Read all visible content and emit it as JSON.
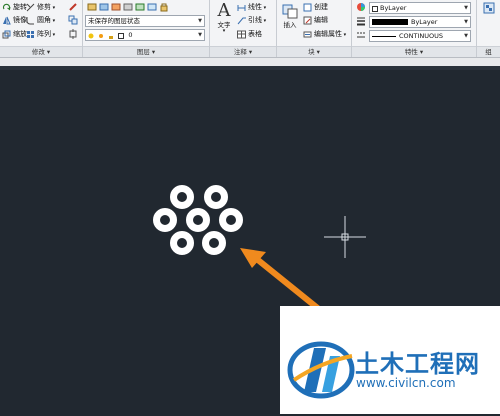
{
  "ribbon": {
    "modify": {
      "rotate": "旋转",
      "mirror": "镜像",
      "scale": "缩放",
      "trim": "修剪",
      "fillet": "圆角",
      "array": "阵列",
      "panel_label": "修改"
    },
    "layers": {
      "state_combo": "未保存的图层状态",
      "layer_combo": "0",
      "panel_label": "图层"
    },
    "annotation": {
      "text_button": "文字",
      "linear": "线性",
      "leader": "引线",
      "table": "表格",
      "panel_label": "注释"
    },
    "block": {
      "insert_button": "插入",
      "create": "创建",
      "edit": "编辑",
      "edit_attributes": "编辑属性",
      "panel_label": "块"
    },
    "properties": {
      "color_value": "ByLayer",
      "lineweight_value": "ByLayer",
      "linetype_value": "CONTINUOUS",
      "panel_label": "特性"
    },
    "groups": {
      "panel_label": "组"
    }
  },
  "watermark": {
    "title": "土木工程网",
    "url": "www.civilcn.com"
  },
  "colors": {
    "canvas": "#212830",
    "arrow": "#f08a1e",
    "brand_blue": "#1f6fb8"
  }
}
